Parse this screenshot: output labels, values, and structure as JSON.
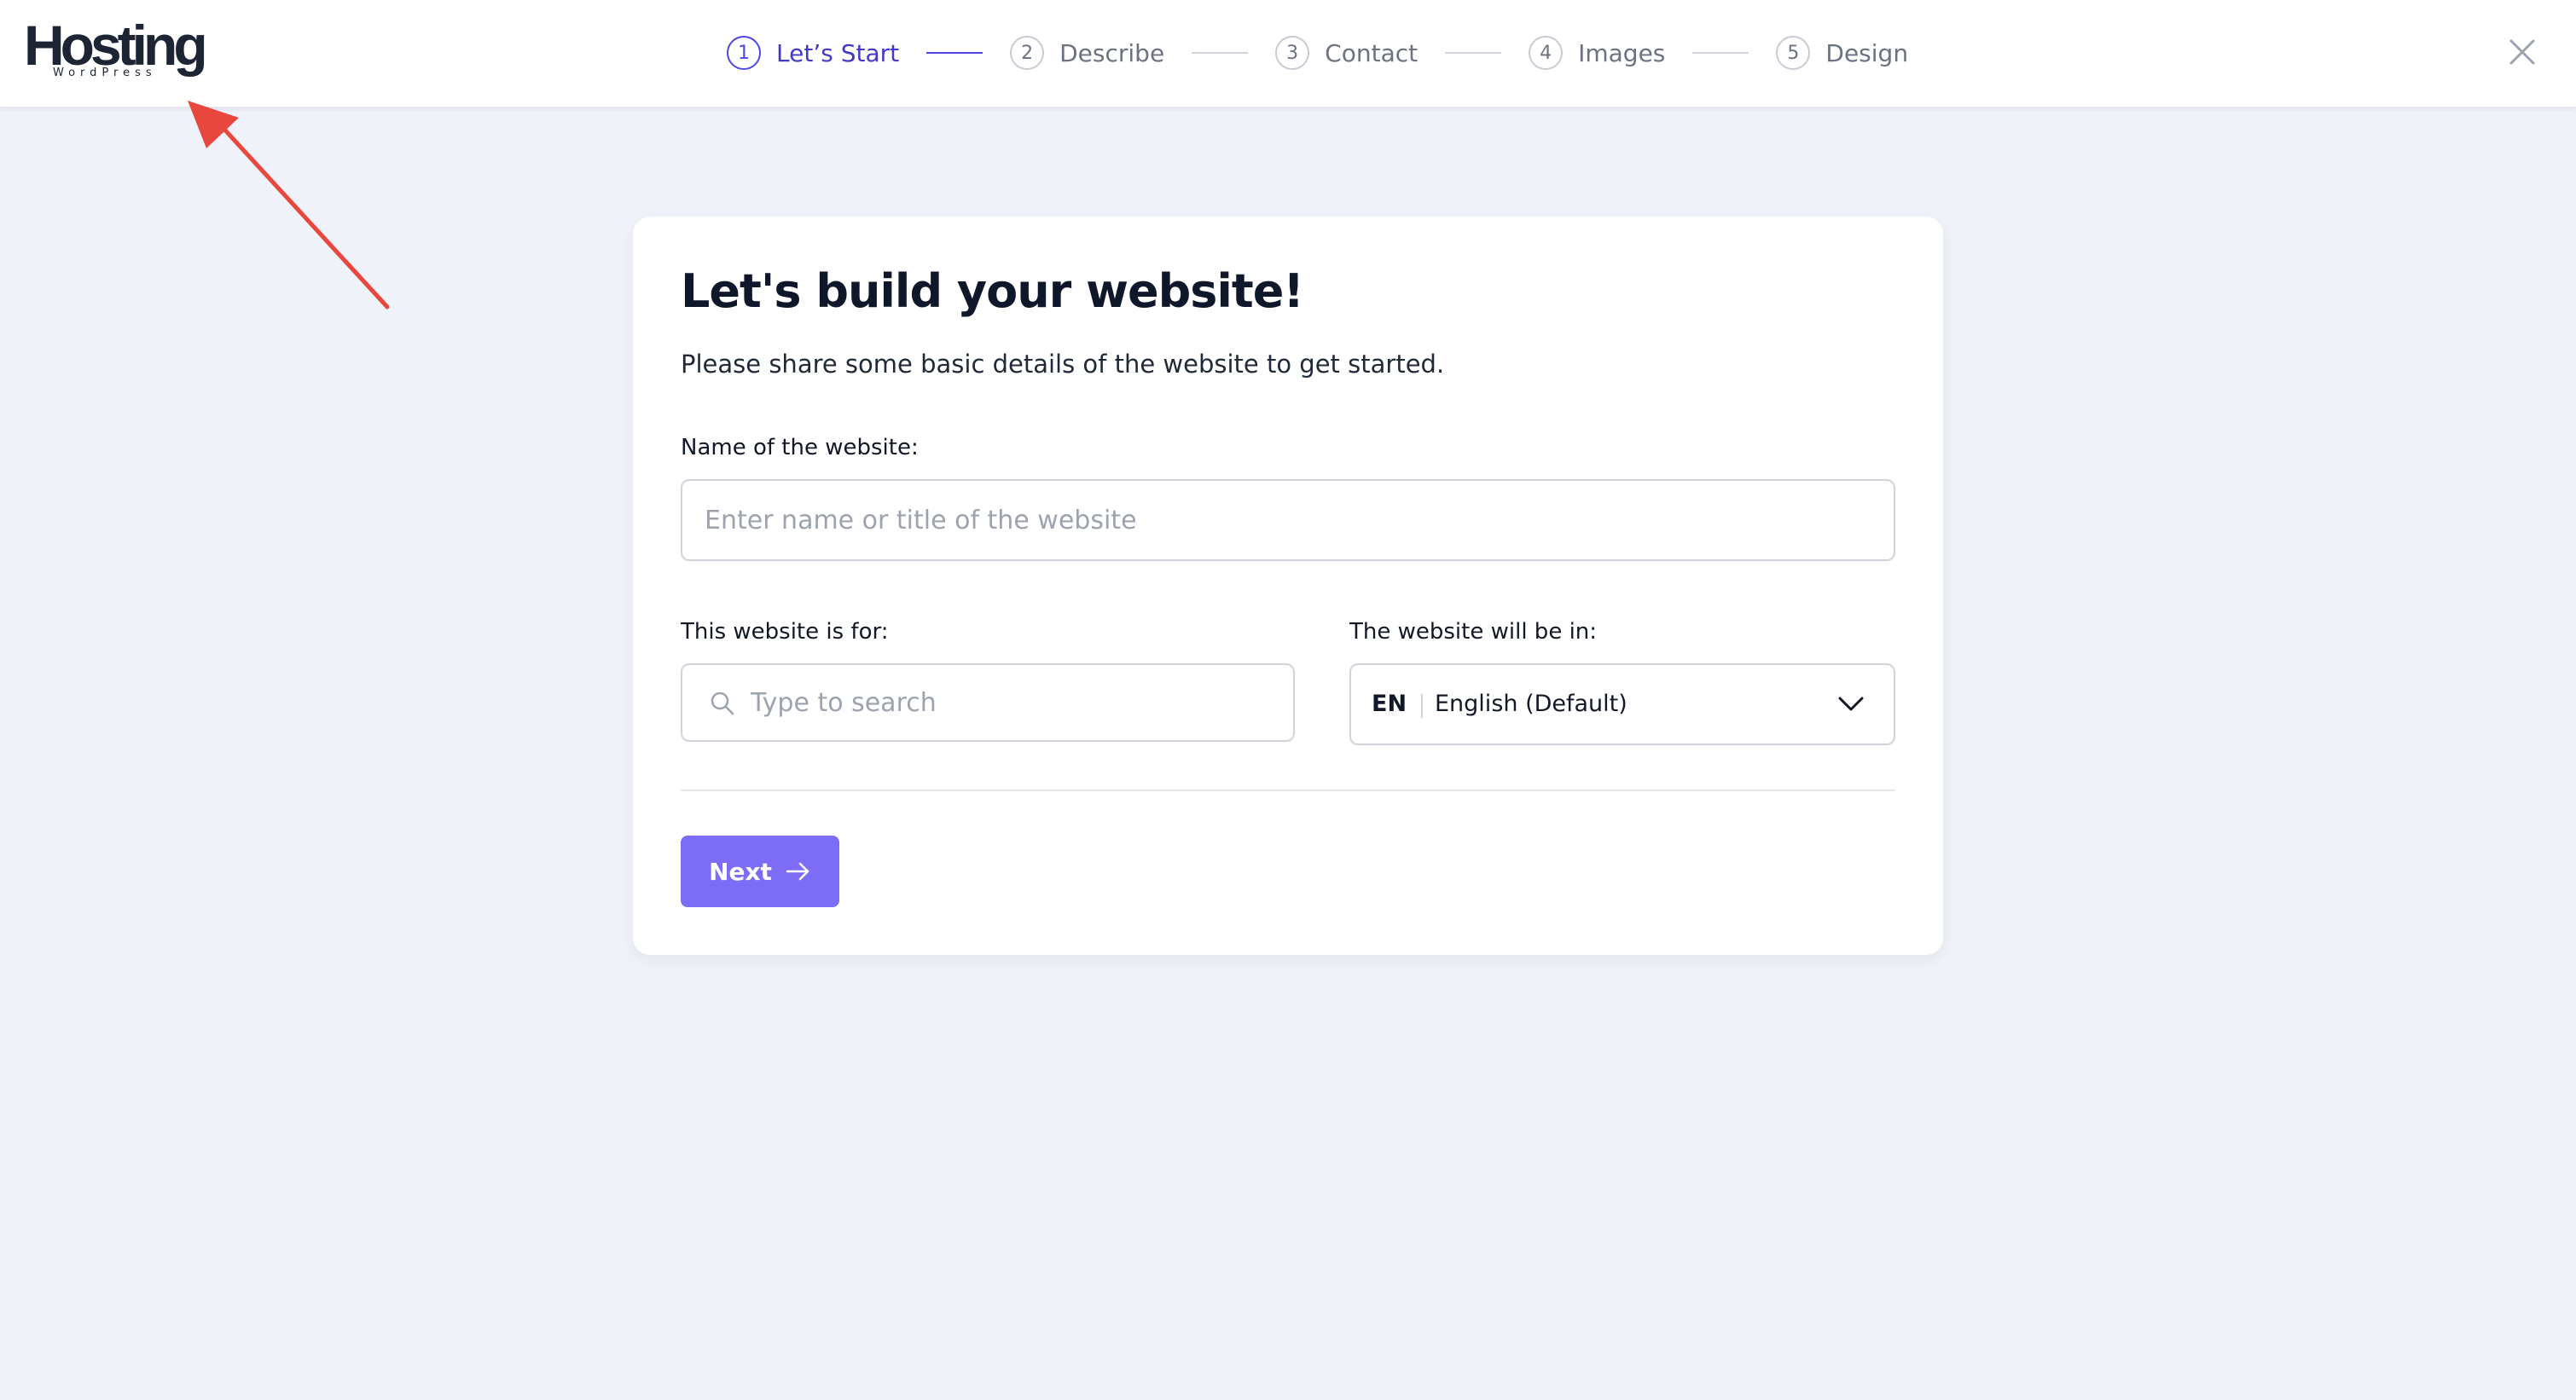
{
  "header": {
    "logo": {
      "main": "Hosting",
      "sub": "WordPress"
    },
    "steps": [
      {
        "number": "1",
        "label": "Let’s Start",
        "active": true
      },
      {
        "number": "2",
        "label": "Describe",
        "active": false
      },
      {
        "number": "3",
        "label": "Contact",
        "active": false
      },
      {
        "number": "4",
        "label": "Images",
        "active": false
      },
      {
        "number": "5",
        "label": "Design",
        "active": false
      }
    ],
    "close_icon": "close-icon"
  },
  "card": {
    "title": "Let's build your website!",
    "subtitle": "Please share some basic details of the website to get started.",
    "name_field": {
      "label": "Name of the website:",
      "value": "",
      "placeholder": "Enter name or title of the website"
    },
    "purpose_field": {
      "label": "This website is for:",
      "value": "",
      "placeholder": "Type to search",
      "icon": "search-icon"
    },
    "language_field": {
      "label": "The website will be in:",
      "code": "EN",
      "selected": "English (Default)",
      "icon": "chevron-down-icon"
    },
    "next_button": {
      "label": "Next",
      "icon": "arrow-right-icon"
    }
  },
  "colors": {
    "accent": "#4f46e5",
    "button": "#7c6cf6",
    "background": "#f0f2f9",
    "annotation": "#e8473d"
  }
}
